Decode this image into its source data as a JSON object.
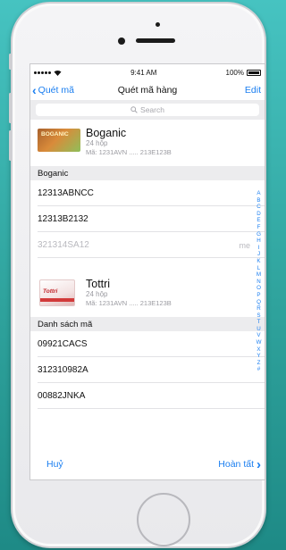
{
  "status_bar": {
    "time": "9:41 AM",
    "battery": "100%"
  },
  "nav": {
    "back_label": "Quét mã",
    "title": "Quét mã hàng",
    "edit_label": "Edit"
  },
  "search": {
    "placeholder": "Search"
  },
  "products": [
    {
      "name": "Boganic",
      "quantity": "24 hộp",
      "code": "Mã: 1231AVN ..... 213E123B",
      "thumb_text": "BOGANIC",
      "section_header": "Boganic",
      "codes": [
        {
          "value": "12313ABNCC"
        },
        {
          "value": "12313B2132"
        },
        {
          "value": "321314SA12",
          "note": "me"
        }
      ]
    },
    {
      "name": "Tottri",
      "quantity": "24 hộp",
      "code": "Mã: 1231AVN ..... 213E123B",
      "thumb_text": "Tottri",
      "section_header": "Danh sách mã",
      "codes": [
        {
          "value": "09921CACS"
        },
        {
          "value": "312310982A"
        },
        {
          "value": "00882JNKA"
        }
      ]
    }
  ],
  "index_letters": [
    "A",
    "B",
    "C",
    "D",
    "E",
    "F",
    "G",
    "H",
    "I",
    "J",
    "K",
    "L",
    "M",
    "N",
    "O",
    "P",
    "Q",
    "R",
    "S",
    "T",
    "U",
    "V",
    "W",
    "X",
    "Y",
    "Z",
    "#"
  ],
  "footer": {
    "cancel_label": "Huỷ",
    "done_label": "Hoàn tất"
  },
  "colors": {
    "accent": "#1a7ef0",
    "background_teal": "#2fa39d",
    "section_bg": "#ececee"
  },
  "icons": {
    "back": "chevron-left-icon",
    "search": "search-icon",
    "done": "chevron-right-icon"
  }
}
